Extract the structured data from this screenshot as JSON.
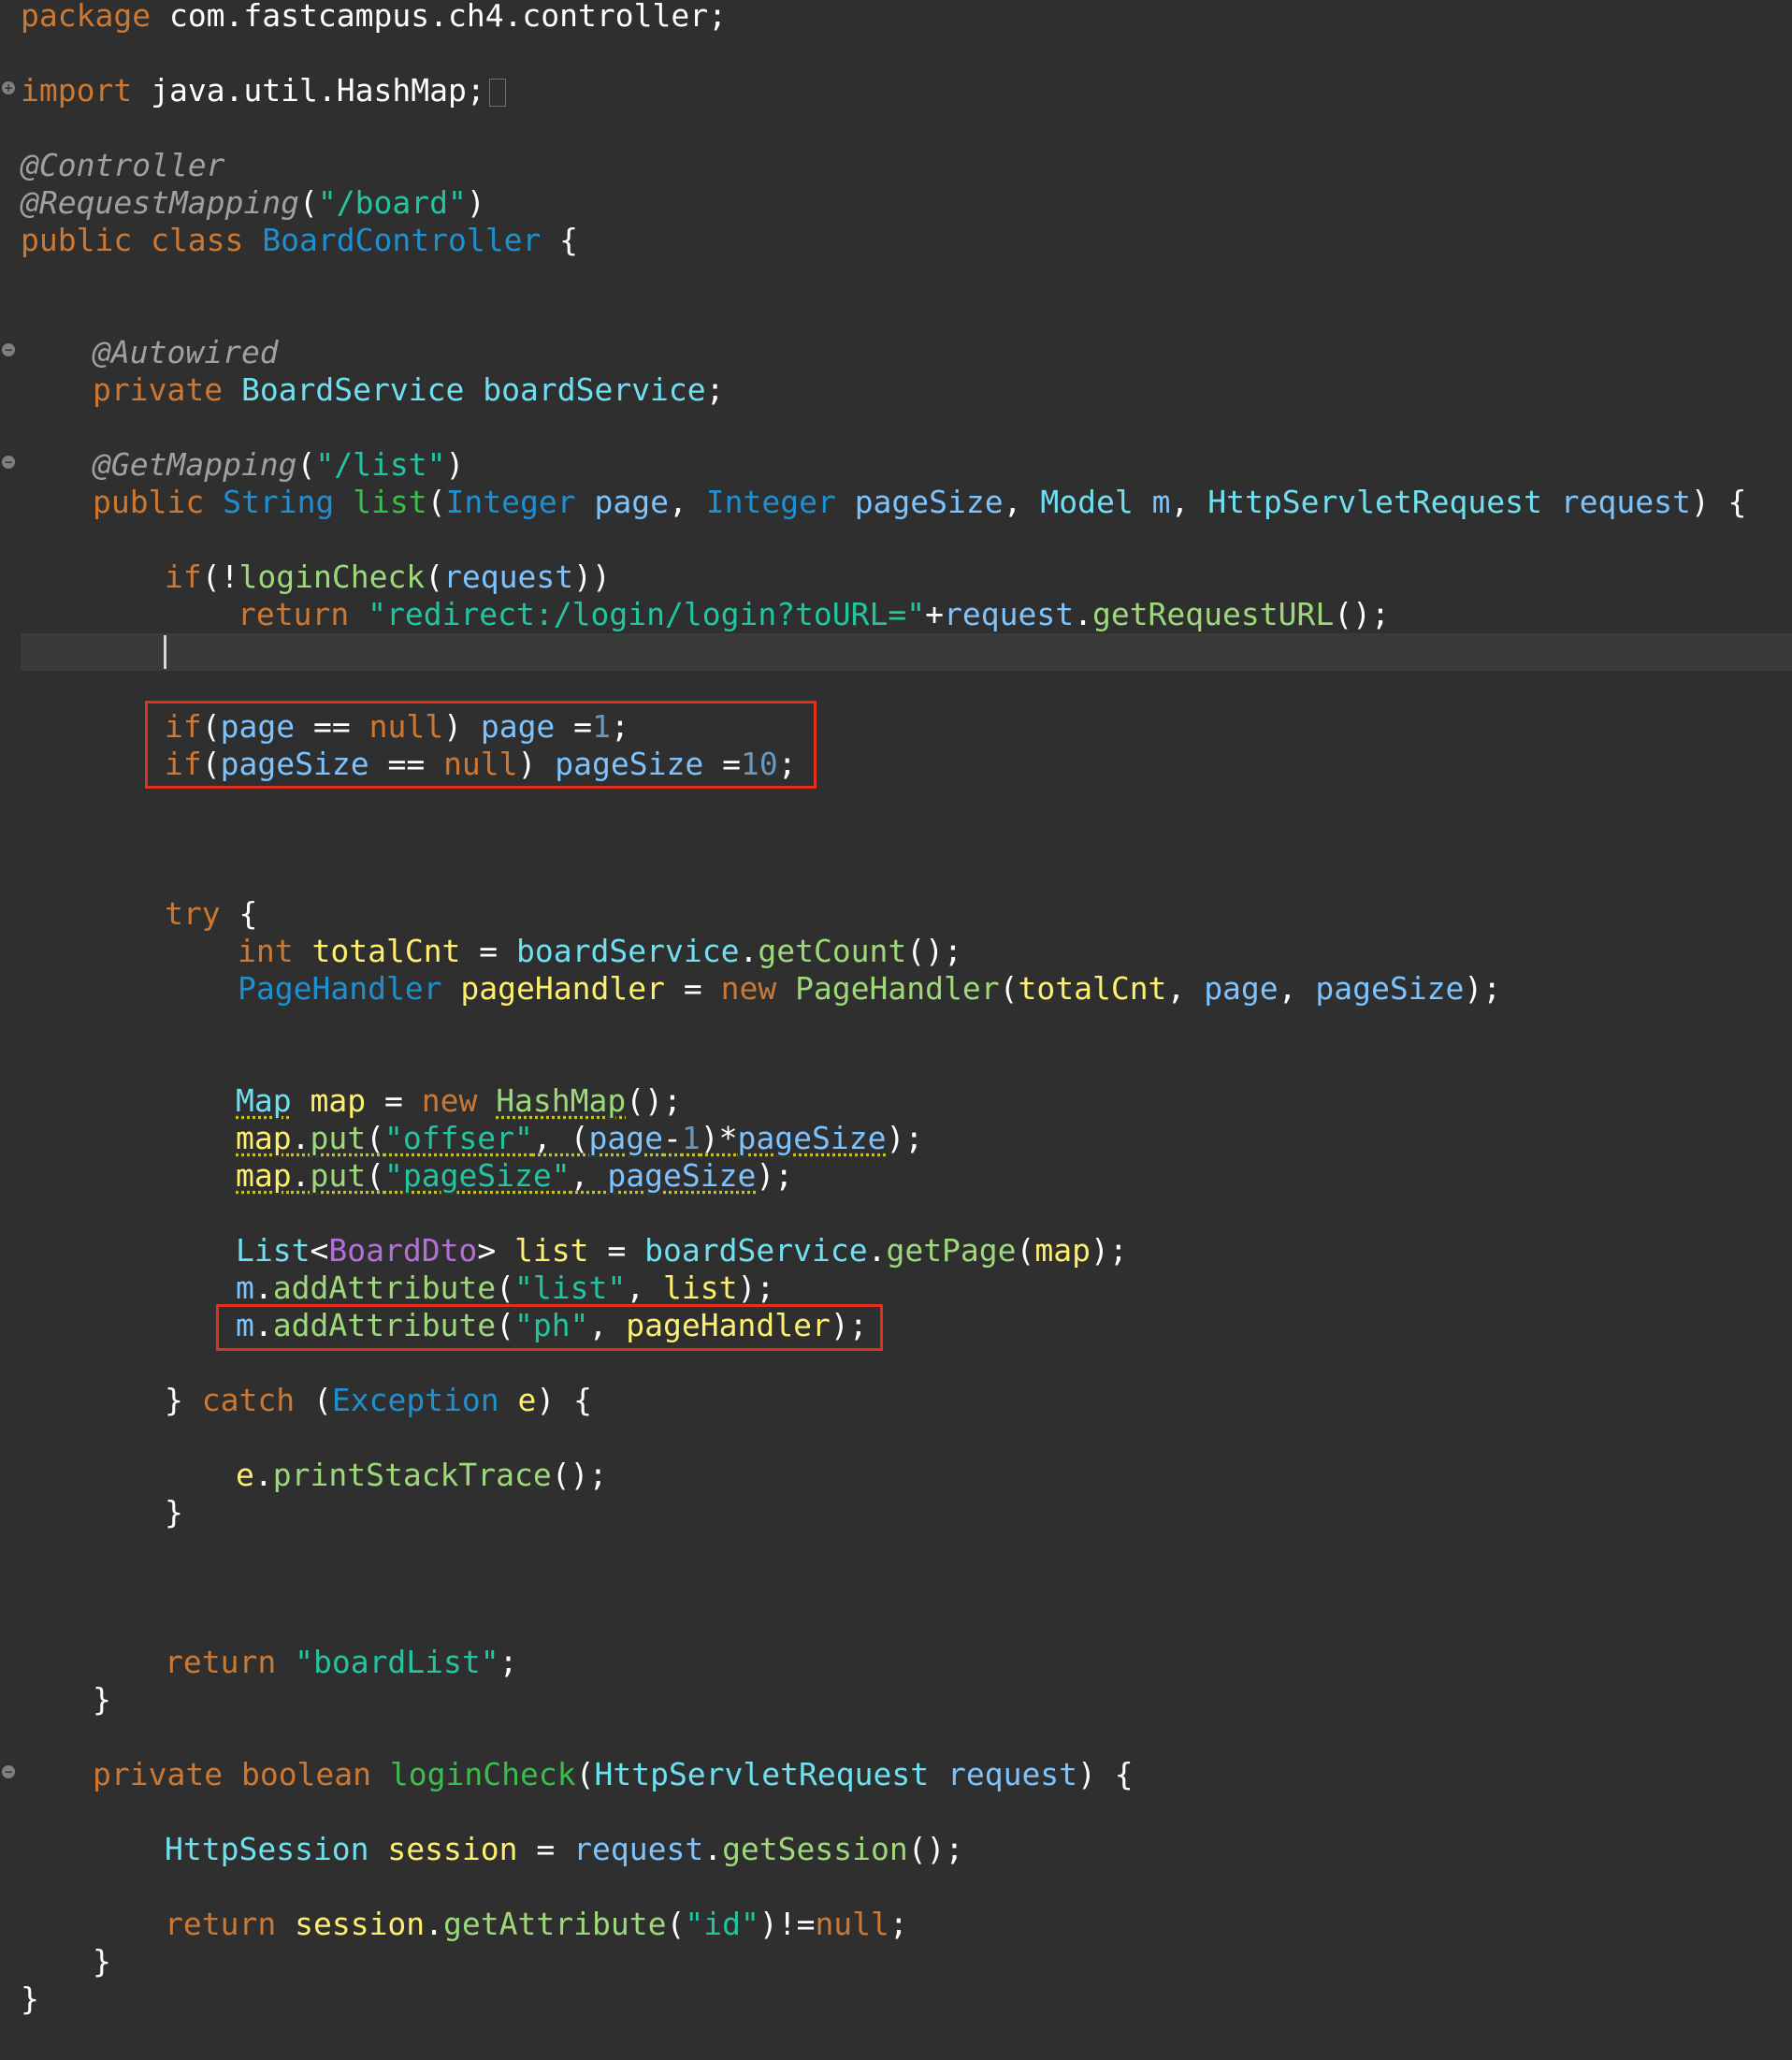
{
  "editor": {
    "colors": {
      "background": "#2f2f2f",
      "keyword": "#cc7832",
      "string": "#23c4a0",
      "highlight_box": "#e0301e"
    },
    "lines": {
      "l1": [
        "package",
        " com.fastcampus.ch4.controller;"
      ],
      "l2": [
        "import",
        " java.util.HashMap;"
      ],
      "l3": [
        "@Controller"
      ],
      "l4": [
        "@RequestMapping",
        "(",
        "\"/board\"",
        ")"
      ],
      "l5": [
        "public class",
        " ",
        "BoardController",
        " {"
      ],
      "l6": [
        "@Autowired"
      ],
      "l7": [
        "private",
        " ",
        "BoardService",
        " ",
        "boardService",
        ";"
      ],
      "l8": [
        "@GetMapping",
        "(",
        "\"/list\"",
        ")"
      ],
      "l9": [
        "public",
        " ",
        "String",
        " ",
        "list",
        "(",
        "Integer",
        " ",
        "page",
        ", ",
        "Integer",
        " ",
        "pageSize",
        ", ",
        "Model",
        " ",
        "m",
        ", ",
        "HttpServletRequest",
        " ",
        "request",
        ") {"
      ],
      "l10": [
        "if",
        "(!",
        "loginCheck",
        "(",
        "request",
        "))"
      ],
      "l11": [
        "return",
        " ",
        "\"redirect:/login/login?toURL=\"",
        "+",
        "request",
        ".",
        "getRequestURL",
        "();"
      ],
      "l12": [
        "if",
        "(",
        "page",
        " == ",
        "null",
        ") ",
        "page",
        " =",
        "1",
        ";"
      ],
      "l13": [
        "if",
        "(",
        "pageSize",
        " == ",
        "null",
        ") ",
        "pageSize",
        " =",
        "10",
        ";"
      ],
      "l14": [
        "try",
        " {"
      ],
      "l15": [
        "int",
        " ",
        "totalCnt",
        " = ",
        "boardService",
        ".",
        "getCount",
        "();"
      ],
      "l16": [
        "PageHandler",
        " ",
        "pageHandler",
        " = ",
        "new",
        " ",
        "PageHandler",
        "(",
        "totalCnt",
        ", ",
        "page",
        ", ",
        "pageSize",
        ");"
      ],
      "l17": [
        "Map",
        " ",
        "map",
        " = ",
        "new",
        " ",
        "HashMap",
        "();"
      ],
      "l18": [
        "map",
        ".",
        "put",
        "(",
        "\"offser\"",
        ", (",
        "page",
        "-",
        "1",
        ")*",
        "pageSize",
        ");"
      ],
      "l19": [
        "map",
        ".",
        "put",
        "(",
        "\"pageSize\"",
        ", ",
        "pageSize",
        ");"
      ],
      "l20": [
        "List",
        "<",
        "BoardDto",
        "> ",
        "list",
        " = ",
        "boardService",
        ".",
        "getPage",
        "(",
        "map",
        ");"
      ],
      "l21": [
        "m",
        ".",
        "addAttribute",
        "(",
        "\"list\"",
        ", ",
        "list",
        ");"
      ],
      "l22": [
        "m",
        ".",
        "addAttribute",
        "(",
        "\"ph\"",
        ", ",
        "pageHandler",
        ");"
      ],
      "l23": [
        "} ",
        "catch",
        " (",
        "Exception",
        " ",
        "e",
        ") {"
      ],
      "l24": [
        "e",
        ".",
        "printStackTrace",
        "();"
      ],
      "l25": [
        "}"
      ],
      "l26": [
        "return",
        " ",
        "\"boardList\"",
        ";"
      ],
      "l27": [
        "}"
      ],
      "l28": [
        "private",
        " ",
        "boolean",
        " ",
        "loginCheck",
        "(",
        "HttpServletRequest",
        " ",
        "request",
        ") {"
      ],
      "l29": [
        "HttpSession",
        " ",
        "session",
        " = ",
        "request",
        ".",
        "getSession",
        "();"
      ],
      "l30": [
        "return",
        " ",
        "session",
        ".",
        "getAttribute",
        "(",
        "\"id\"",
        ")!=",
        "null",
        ";"
      ],
      "l31": [
        "}"
      ],
      "l32": [
        "}"
      ]
    },
    "gutter": {
      "expand_icon": "+",
      "collapse_icon": "−"
    }
  }
}
